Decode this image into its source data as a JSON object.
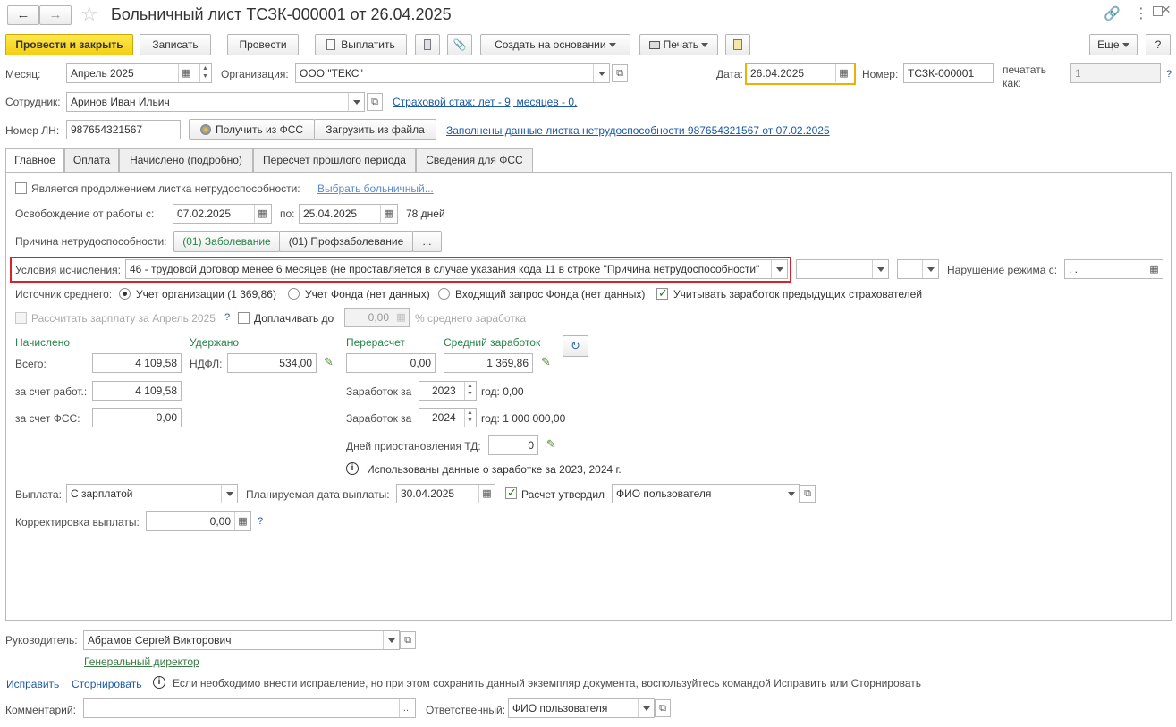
{
  "window": {
    "title": "Больничный лист ТСЗК-000001 от 26.04.2025",
    "back_icon": "arrow-left-icon",
    "forward_icon": "arrow-right-icon",
    "star_icon": "star-icon",
    "link_icon": "link-icon",
    "more_icon": "more-vertical-icon",
    "maximize_icon": "maximize-icon",
    "close_icon": "close-icon"
  },
  "toolbar": {
    "post_close": "Провести и закрыть",
    "save": "Записать",
    "post": "Провести",
    "pay": "Выплатить",
    "create_based": "Создать на основании",
    "print": "Печать",
    "more": "Еще",
    "help": "?"
  },
  "header": {
    "month_label": "Месяц:",
    "month_value": "Апрель 2025",
    "org_label": "Организация:",
    "org_value": "ООО \"ТЕКС\"",
    "date_label": "Дата:",
    "date_value": "26.04.2025",
    "number_label": "Номер:",
    "number_value": "ТСЗК-000001",
    "print_as_label": "печатать как:",
    "print_as_value": "1",
    "help": "?",
    "employee_label": "Сотрудник:",
    "employee_value": "Аринов Иван Ильич",
    "insurance_link": "Страховой стаж: лет - 9; месяцев - 0.",
    "ln_label": "Номер ЛН:",
    "ln_value": "987654321567",
    "get_fss_btn": "Получить из ФСС",
    "load_file_btn": "Загрузить из файла",
    "filled_link": "Заполнены данные листка нетрудоспособности 987654321567 от 07.02.2025"
  },
  "tabs": [
    {
      "label": "Главное"
    },
    {
      "label": "Оплата"
    },
    {
      "label": "Начислено (подробно)"
    },
    {
      "label": "Пересчет прошлого периода"
    },
    {
      "label": "Сведения для ФСС"
    }
  ],
  "main": {
    "continuation_label": "Является продолжением листка нетрудоспособности:",
    "choose_sick_link": "Выбрать больничный...",
    "release_label": "Освобождение от работы с:",
    "release_from": "07.02.2025",
    "release_to_label": "по:",
    "release_to": "25.04.2025",
    "days": "78 дней",
    "cause_label": "Причина нетрудоспособности:",
    "cause_btn1": "(01) Заболевание",
    "cause_btn2": "(01) Профзаболевание",
    "cause_btn3": "...",
    "conditions_label": "Условия исчисления:",
    "conditions_value": "46 - трудовой договор менее 6 месяцев (не проставляется в случае указания кода 11 в строке \"Причина нетрудоспособности\"",
    "violation_label": "Нарушение режима с:",
    "violation_value": " .  .",
    "avg_source_label": "Источник среднего:",
    "src_org": "Учет организации (1 369,86)",
    "src_fund": "Учет Фонда (нет данных)",
    "src_request": "Входящий запрос Фонда (нет данных)",
    "prev_insurers": "Учитывать заработок предыдущих страхователей",
    "calc_salary": "Рассчитать зарплату за Апрель 2025",
    "calc_help": "?",
    "pay_extra": "Доплачивать до",
    "pay_extra_value": "0,00",
    "pay_extra_suffix": "% среднего заработка",
    "accrued_title": "Начислено",
    "withheld_title": "Удержано",
    "recalc_title": "Перерасчет",
    "avg_title": "Средний заработок",
    "total_label": "Всего:",
    "total_value": "4 109,58",
    "ndfl_label": "НДФЛ:",
    "ndfl_value": "534,00",
    "recalc_value": "0,00",
    "avg_value": "1 369,86",
    "employer_label": "за счет работ.:",
    "employer_value": "4 109,58",
    "fss_label": "за счет ФСС:",
    "fss_value": "0,00",
    "earnings_label": "Заработок за",
    "year1": "2023",
    "year1_income": "год: 0,00",
    "year2": "2024",
    "year2_income": "год: 1 000 000,00",
    "suspension_label": "Дней приостановления ТД:",
    "suspension_value": "0",
    "info_text": "Использованы данные о заработке за  2023,  2024 г.",
    "payout_label": "Выплата:",
    "payout_value": "С зарплатой",
    "planned_label": "Планируемая дата выплаты:",
    "planned_value": "30.04.2025",
    "approved_label": "Расчет утвердил",
    "approved_value": "ФИО пользователя",
    "correction_label": "Корректировка выплаты:",
    "correction_value": "0,00",
    "correction_help": "?"
  },
  "footer": {
    "head_label": "Руководитель:",
    "head_value": "Абрамов Сергей Викторович",
    "head_position": "Генеральный директор",
    "fix_link": "Исправить",
    "reverse_link": "Сторнировать",
    "fix_info": "Если необходимо внести исправление, но при этом сохранить данный экземпляр документа, воспользуйтесь командой Исправить или Сторнировать",
    "comment_label": "Комментарий:",
    "comment_value": "",
    "comment_btn": "...",
    "responsible_label": "Ответственный:",
    "responsible_value": "ФИО пользователя"
  },
  "colors": {
    "primary_button": "#f4cf14",
    "highlight_border": "#d8232a",
    "active_date_border": "#f0b000",
    "section_green": "#28844a",
    "link_blue": "#1c5aa6"
  }
}
